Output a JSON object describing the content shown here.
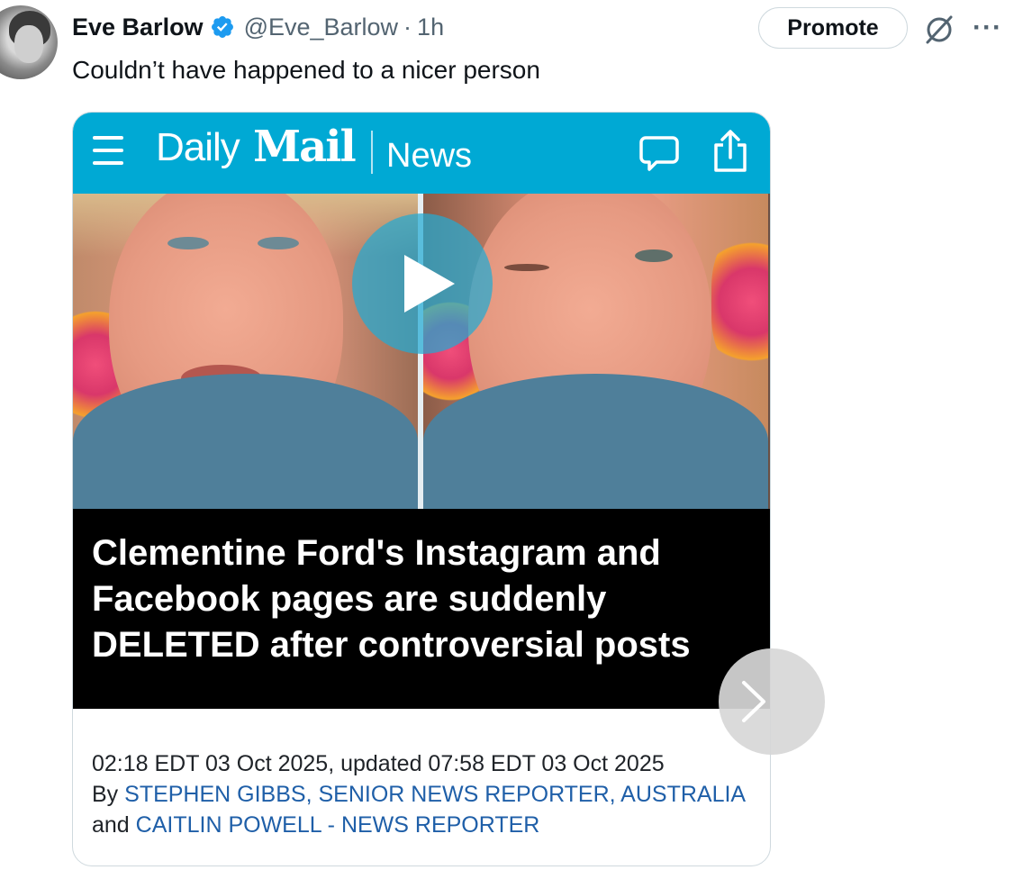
{
  "tweet": {
    "author_name": "Eve Barlow",
    "handle": "@Eve_Barlow",
    "separator": "·",
    "time": "1h",
    "promote_label": "Promote",
    "more_label": "···",
    "text": "Couldn’t have happened to a nicer person"
  },
  "card": {
    "brand_daily": "Daily",
    "brand_mail": "Mail",
    "brand_section": "News",
    "headline": "Clementine Ford's Instagram and Facebook pages are suddenly DELETED after controversial posts",
    "timestamp": "02:18 EDT 03 Oct 2025, updated 07:58 EDT 03 Oct 2025",
    "byline_prefix": "By",
    "author_1": "STEPHEN GIBBS, SENIOR NEWS REPORTER, AUSTRALIA",
    "byline_joiner": "and",
    "author_2": "CAITLIN POWELL - NEWS REPORTER"
  },
  "colors": {
    "brand_bar": "#00a9d4",
    "verified_badge": "#1d9bf0",
    "author_link": "#1f5fa8"
  }
}
